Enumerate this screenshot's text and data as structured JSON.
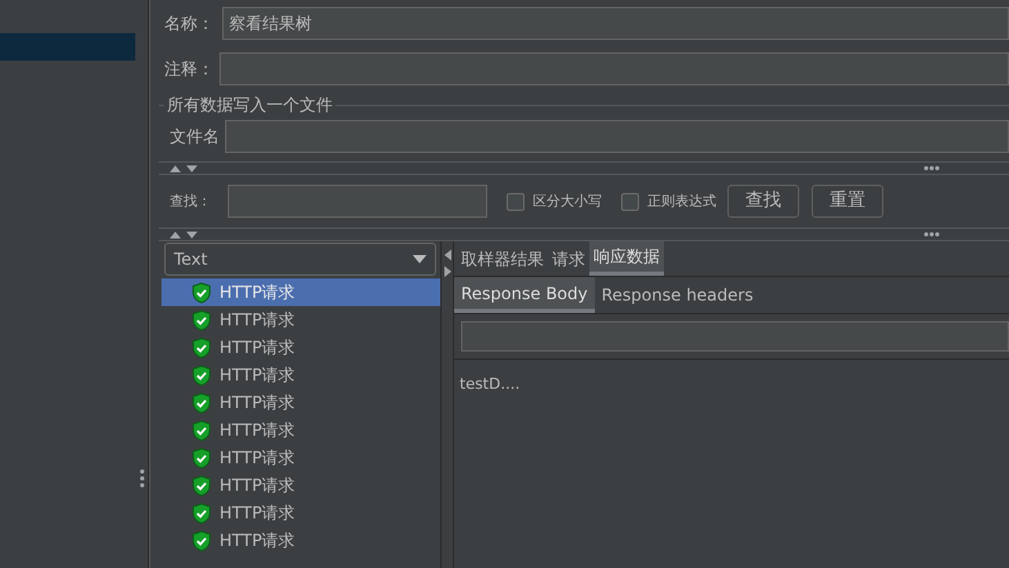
{
  "sidebar": {
    "items": [
      {
        "selected": true
      }
    ]
  },
  "name_field": {
    "label": "名称：",
    "value": "察看结果树"
  },
  "comment_field": {
    "label": "注释："
  },
  "file_group": {
    "title": "所有数据写入一个文件",
    "label": "文件名"
  },
  "search": {
    "label": "查找：",
    "options": [
      {
        "label": "区分大小写",
        "checked": false
      },
      {
        "label": "正则表达式",
        "checked": false
      }
    ],
    "buttons": [
      "查找",
      "重置"
    ]
  },
  "renderer": {
    "value": "Text"
  },
  "results": [
    {
      "label": "HTTP请求",
      "selected": true
    },
    {
      "label": "HTTP请求",
      "selected": false
    },
    {
      "label": "HTTP请求",
      "selected": false
    },
    {
      "label": "HTTP请求",
      "selected": false
    },
    {
      "label": "HTTP请求",
      "selected": false
    },
    {
      "label": "HTTP请求",
      "selected": false
    },
    {
      "label": "HTTP请求",
      "selected": false
    },
    {
      "label": "HTTP请求",
      "selected": false
    },
    {
      "label": "HTTP请求",
      "selected": false
    },
    {
      "label": "HTTP请求",
      "selected": false
    }
  ],
  "tabs": [
    {
      "label": "取样器结果",
      "selected": false
    },
    {
      "label": "请求",
      "selected": false
    },
    {
      "label": "响应数据",
      "selected": true
    }
  ],
  "subtabs": [
    {
      "label": "Response Body",
      "selected": true
    },
    {
      "label": "Response headers",
      "selected": false
    }
  ],
  "body": "testD...."
}
